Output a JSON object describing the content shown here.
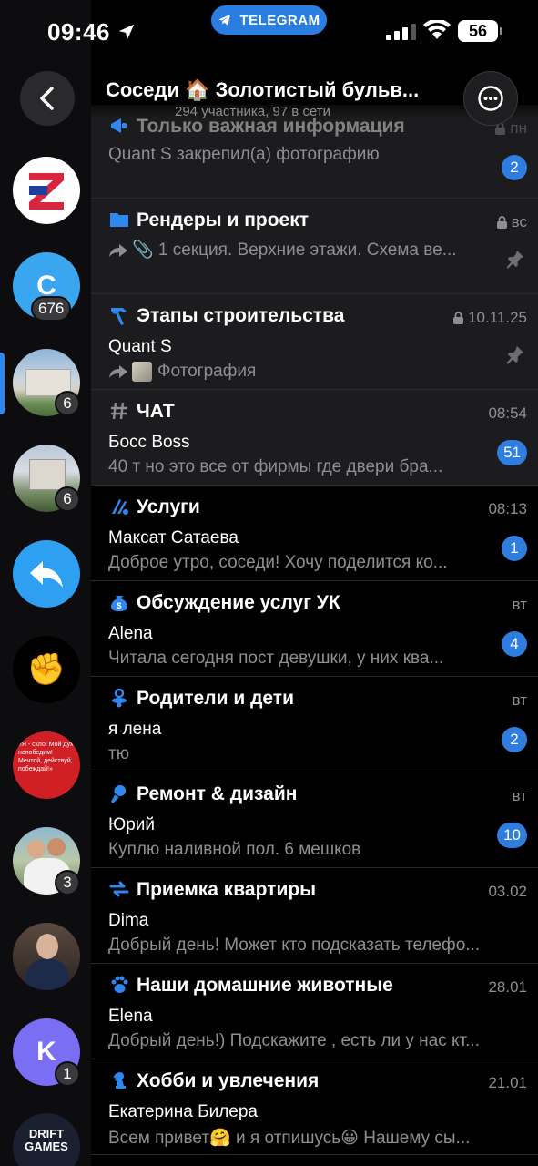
{
  "status_bar": {
    "time": "09:46",
    "app_pill": "TELEGRAM",
    "battery": "56"
  },
  "header": {
    "title": "Соседи 🏠 Золотистый бульв...",
    "subtitle": "294 участника, 97 в сети"
  },
  "sidebar": {
    "items": [
      {
        "type": "logo-z",
        "badge": ""
      },
      {
        "type": "letter",
        "letter": "C",
        "color": "#3aa6f0",
        "badge": "676"
      },
      {
        "type": "photo",
        "badge": "6",
        "active": true
      },
      {
        "type": "photo",
        "badge": "6"
      },
      {
        "type": "reply",
        "badge": ""
      },
      {
        "type": "fist",
        "badge": ""
      },
      {
        "type": "photo-red",
        "text": "«Я - скло! Мой дух непобедим! Мечтой, действуй, побеждай!»",
        "badge": ""
      },
      {
        "type": "photo",
        "badge": "3"
      },
      {
        "type": "photo",
        "badge": ""
      },
      {
        "type": "letter",
        "letter": "K",
        "color": "#7a6ef5",
        "badge": "1"
      },
      {
        "type": "photo-dark",
        "text": "DRIFT GAMES",
        "badge": ""
      }
    ]
  },
  "topics": [
    {
      "icon": "megaphone",
      "title": "Только важная информация",
      "time": "пн",
      "locked": true,
      "sender": "",
      "preview": "Quant S закрепил(а) фотографию",
      "badge": "2",
      "pinned": false,
      "grey": true,
      "faded": true
    },
    {
      "icon": "folder",
      "title": "Рендеры и проект",
      "time": "вс",
      "locked": true,
      "sender": "",
      "preview": "📎 1 секция. Верхние этажи. Схема ве...",
      "forwarded": true,
      "badge": "",
      "pinned": true,
      "grey": true
    },
    {
      "icon": "hammer",
      "title": "Этапы строительства",
      "time": "10.11.25",
      "locked": true,
      "sender": "Quant S",
      "preview": "Фотография",
      "forwarded": true,
      "thumb": true,
      "badge": "",
      "pinned": true,
      "grey": true
    },
    {
      "icon": "hash",
      "title": "ЧАТ",
      "time": "08:54",
      "locked": false,
      "sender": "Босс Boss",
      "preview": "40 т но это все от фирмы где двери бра...",
      "badge": "51",
      "pinned": false,
      "grey": true
    },
    {
      "icon": "services",
      "title": "Услуги",
      "time": "08:13",
      "locked": false,
      "sender": "Максат Сатаева",
      "preview": "Доброе утро, соседи! Хочу поделится ко...",
      "badge": "1",
      "pinned": false,
      "grey": false
    },
    {
      "icon": "money",
      "title": "Обсуждение услуг УК",
      "time": "вт",
      "locked": false,
      "sender": "Alena",
      "preview": "Читала сегодня пост девушки, у них ква...",
      "badge": "4",
      "pinned": false,
      "grey": false
    },
    {
      "icon": "pacifier",
      "title": "Родители и дети",
      "time": "вт",
      "locked": false,
      "sender": "я лена",
      "preview": "тю",
      "badge": "2",
      "pinned": false,
      "grey": false
    },
    {
      "icon": "brush",
      "title": "Ремонт & дизайн",
      "time": "вт",
      "locked": false,
      "sender": "Юрий",
      "preview": "Куплю наливной пол. 6 мешков",
      "badge": "10",
      "pinned": false,
      "grey": false
    },
    {
      "icon": "swap",
      "title": "Приемка квартиры",
      "time": "03.02",
      "locked": false,
      "sender": "Dima",
      "preview": "Добрый день! Может кто подсказать телефо...",
      "badge": "",
      "pinned": false,
      "grey": false
    },
    {
      "icon": "paw",
      "title": "Наши домашние животные",
      "time": "28.01",
      "locked": false,
      "sender": "Elena",
      "preview": "Добрый день!) Подскажите , есть ли у нас кт...",
      "badge": "",
      "pinned": false,
      "grey": false
    },
    {
      "icon": "chess",
      "title": "Хобби и увлечения",
      "time": "21.01",
      "locked": false,
      "sender": "Екатерина Билера",
      "preview": "Всем привет🤗 и я отпишусь😀 Нашему сы...",
      "badge": "",
      "pinned": false,
      "grey": false
    }
  ],
  "colors": {
    "accent": "#2e7ddf",
    "badge_grey": "#3a3a3c",
    "background": "#000000",
    "row_grey": "#1c1c1e"
  }
}
